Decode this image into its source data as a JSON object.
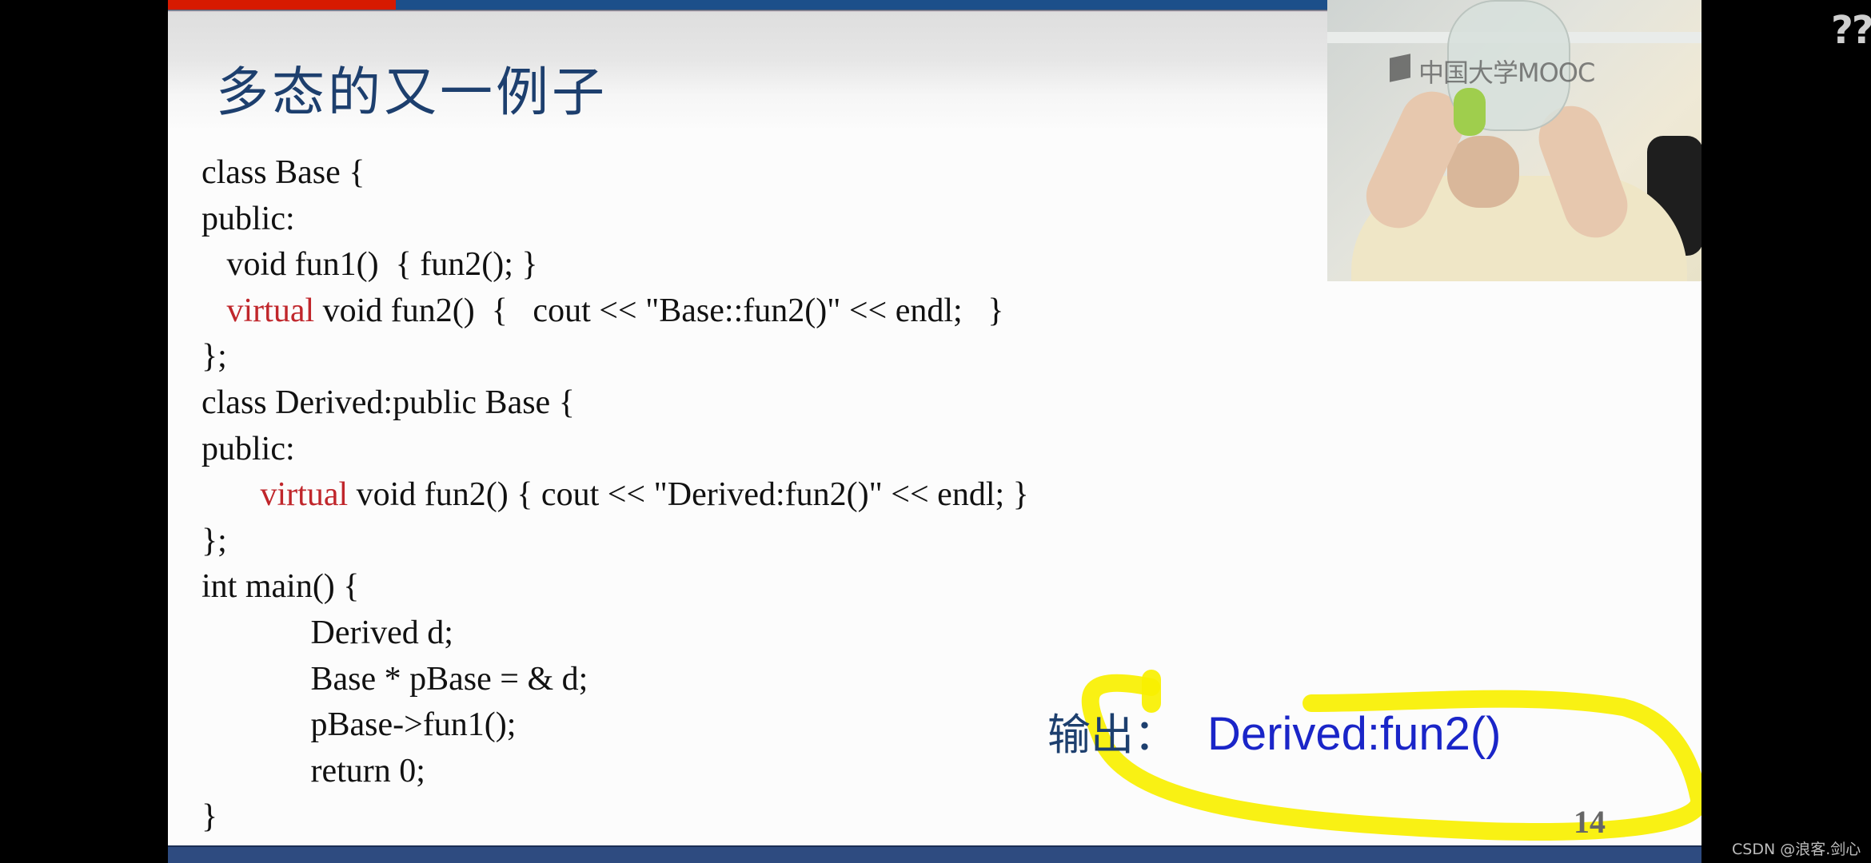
{
  "slide": {
    "title": "多态的又一例子",
    "page_number": "14",
    "code_lines": [
      {
        "indent": "",
        "keyword": "",
        "text": "class Base {"
      },
      {
        "indent": "",
        "keyword": "",
        "text": "public:"
      },
      {
        "indent": "   ",
        "keyword": "",
        "text": "void fun1()  { fun2(); }"
      },
      {
        "indent": "   ",
        "keyword": "virtual",
        "text": " void fun2()  {   cout << \"Base::fun2()\" << endl;   }"
      },
      {
        "indent": "",
        "keyword": "",
        "text": "};"
      },
      {
        "indent": "",
        "keyword": "",
        "text": "class Derived:public Base {"
      },
      {
        "indent": "",
        "keyword": "",
        "text": "public:"
      },
      {
        "indent": "       ",
        "keyword": "virtual",
        "text": " void fun2() { cout << \"Derived:fun2()\" << endl; }"
      },
      {
        "indent": "",
        "keyword": "",
        "text": "};"
      },
      {
        "indent": "",
        "keyword": "",
        "text": "int main() {"
      },
      {
        "indent": "             ",
        "keyword": "",
        "text": "Derived d;"
      },
      {
        "indent": "             ",
        "keyword": "",
        "text": "Base * pBase = & d;"
      },
      {
        "indent": "             ",
        "keyword": "",
        "text": "pBase->fun1();"
      },
      {
        "indent": "             ",
        "keyword": "",
        "text": "return 0;"
      },
      {
        "indent": "",
        "keyword": "",
        "text": "}"
      }
    ],
    "output_label": "输出：",
    "output_value": "Derived:fun2()",
    "annotation": "yellow-highlight-loop"
  },
  "webcam": {
    "watermark": "中国大学MOOC",
    "watermark_icon": "mooc-logo-icon"
  },
  "overlay": {
    "corner_text": "??",
    "credit": "CSDN @浪客.剑心"
  },
  "colors": {
    "title": "#1d3f6e",
    "keyword": "#c0262b",
    "output_value": "#1a25c8",
    "top_red": "#d71a00",
    "top_blue": "#1c4f8a",
    "bottom_bar": "#2e4b80",
    "highlight": "#f8f000"
  }
}
